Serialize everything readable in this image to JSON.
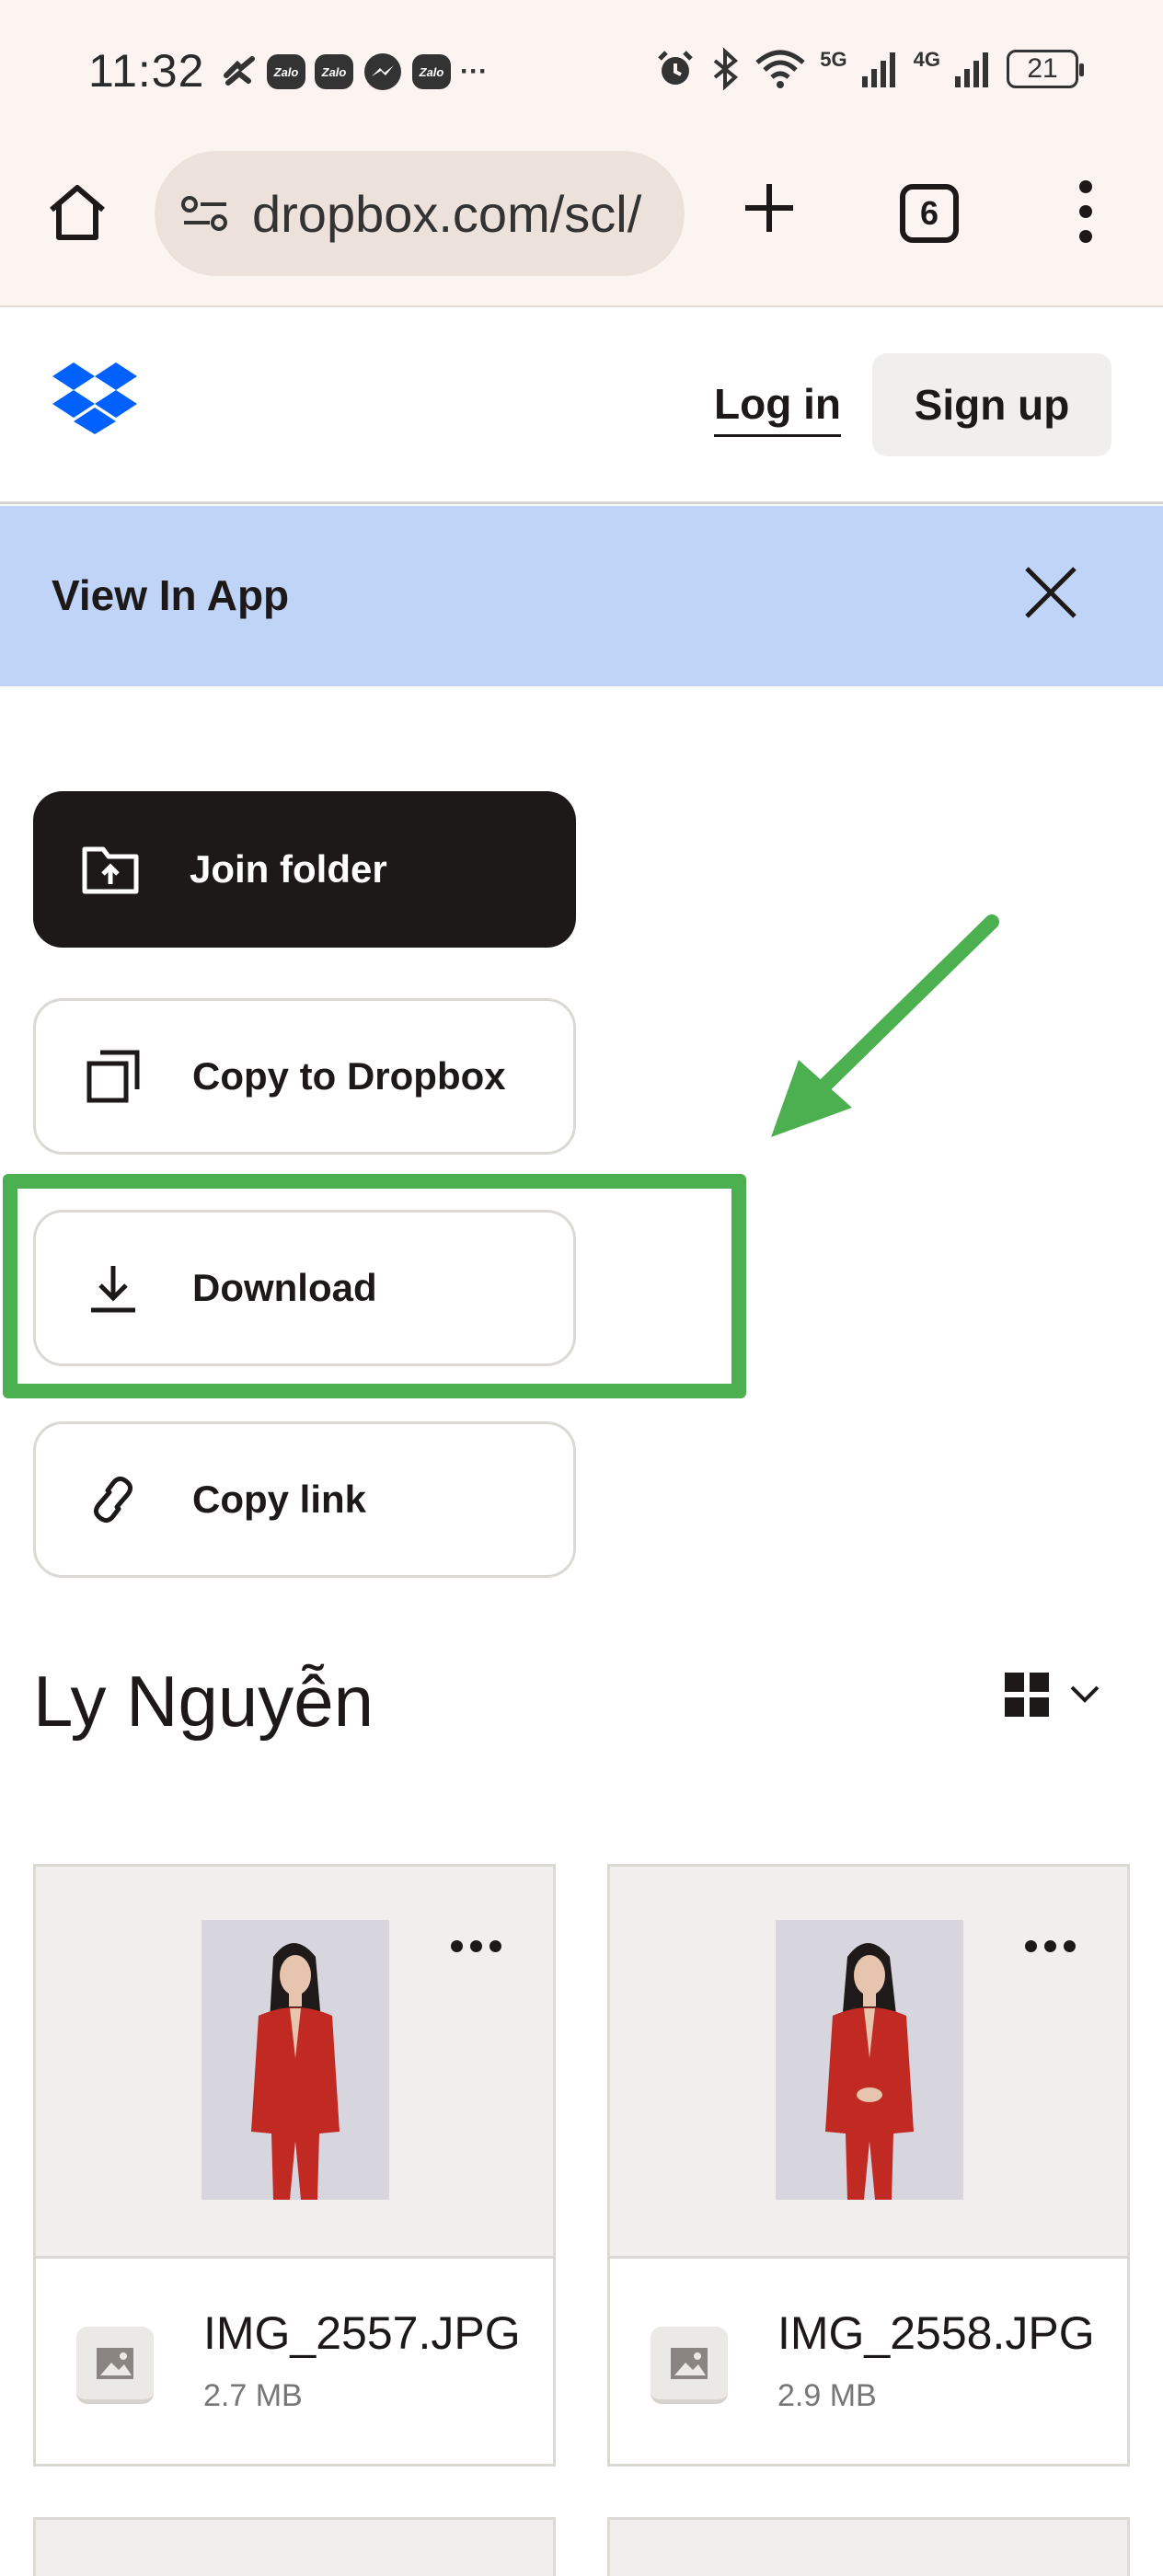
{
  "status_bar": {
    "time": "11:32",
    "zalo_label": "Zalo",
    "more": "···",
    "net1": "5G",
    "net2": "4G",
    "battery": "21"
  },
  "browser": {
    "url": "dropbox.com/scl/",
    "tab_count": "6"
  },
  "header": {
    "login_label": "Log in",
    "signup_label": "Sign up",
    "brand_color": "#0061fe"
  },
  "banner": {
    "text": "View In App"
  },
  "actions": {
    "join": "Join folder",
    "copy": "Copy to Dropbox",
    "download": "Download",
    "link": "Copy link"
  },
  "annotation": {
    "color": "#4caf50"
  },
  "folder": {
    "title": "Ly Nguyễn",
    "files": [
      {
        "name": "IMG_2557.JPG",
        "size": "2.7 MB"
      },
      {
        "name": "IMG_2558.JPG",
        "size": "2.9 MB"
      }
    ]
  }
}
